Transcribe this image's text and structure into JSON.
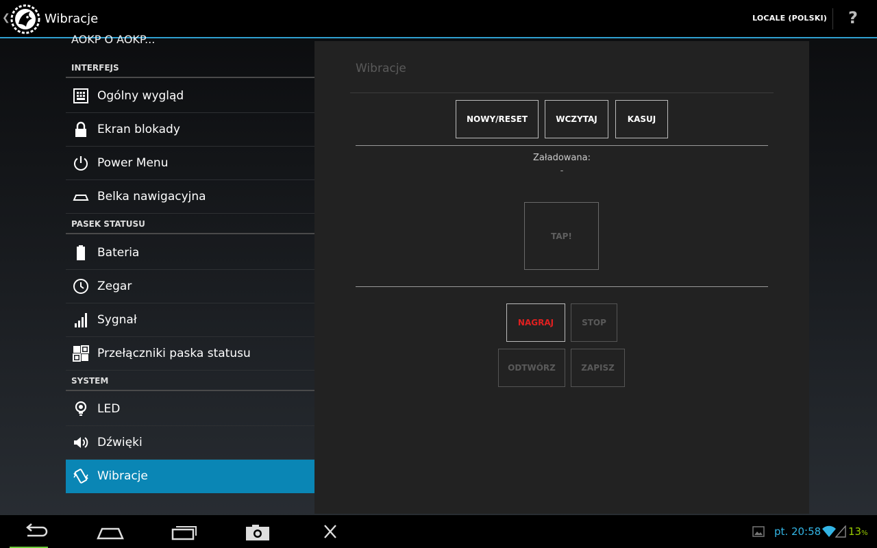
{
  "actionbar": {
    "title": "Wibracje",
    "locale": "LOCALE (POLSKI)",
    "help": "?"
  },
  "left": {
    "cut_item": "AOKP O AOKP...",
    "categories": [
      "INTERFEJS",
      "PASEK STATUSU",
      "SYSTEM"
    ],
    "items": [
      {
        "label": "Ogólny wygląd",
        "icon": "appearance-icon"
      },
      {
        "label": "Ekran blokady",
        "icon": "lock-icon"
      },
      {
        "label": "Power Menu",
        "icon": "power-icon"
      },
      {
        "label": "Belka nawigacyjna",
        "icon": "navbar-icon"
      },
      {
        "label": "Bateria",
        "icon": "battery-icon"
      },
      {
        "label": "Zegar",
        "icon": "clock-icon"
      },
      {
        "label": "Sygnał",
        "icon": "signal-icon"
      },
      {
        "label": "Przełączniki paska statusu",
        "icon": "toggles-icon"
      },
      {
        "label": "LED",
        "icon": "led-icon"
      },
      {
        "label": "Dźwięki",
        "icon": "speaker-icon"
      },
      {
        "label": "Wibracje",
        "icon": "vibrate-icon",
        "active": true
      }
    ]
  },
  "panel": {
    "title": "Wibracje",
    "buttons": {
      "new_reset": "NOWY/RESET",
      "load": "WCZYTAJ",
      "delete": "KASUJ",
      "record": "NAGRAJ",
      "stop": "STOP",
      "play": "ODTWÓRZ",
      "save": "ZAPISZ"
    },
    "loaded_label": "Załadowana:",
    "loaded_value": "-",
    "tap": "TAP!"
  },
  "status": {
    "time": "pt. 20:58",
    "battery": "13",
    "battery_unit": "%"
  },
  "colors": {
    "accent": "#33b5e5",
    "active_item": "#0a86b5",
    "record": "#e02020",
    "battery": "#99cc00"
  }
}
